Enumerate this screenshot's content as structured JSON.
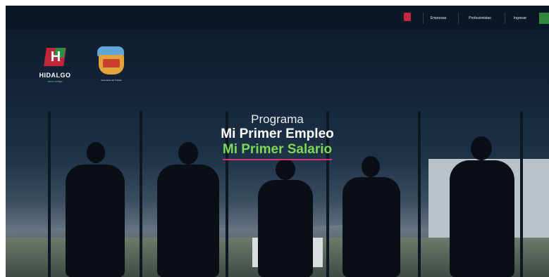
{
  "nav": {
    "items": [
      {
        "label": "Empresas"
      },
      {
        "label": "Profesionistas"
      },
      {
        "label": "Ingresar"
      },
      {
        "label": ""
      }
    ]
  },
  "logos": {
    "hidalgo": {
      "letter": "H",
      "name": "HIDALGO",
      "tagline": "crece contigo"
    },
    "emblem": {
      "caption": "Secretaría del Trabajo"
    }
  },
  "hero": {
    "line1": "Programa",
    "line2": "Mi Primer Empleo",
    "line3": "Mi Primer Salario"
  },
  "colors": {
    "accent_green": "#7ed957",
    "underline_pink": "#d6336c",
    "brand_red": "#c2263a"
  }
}
